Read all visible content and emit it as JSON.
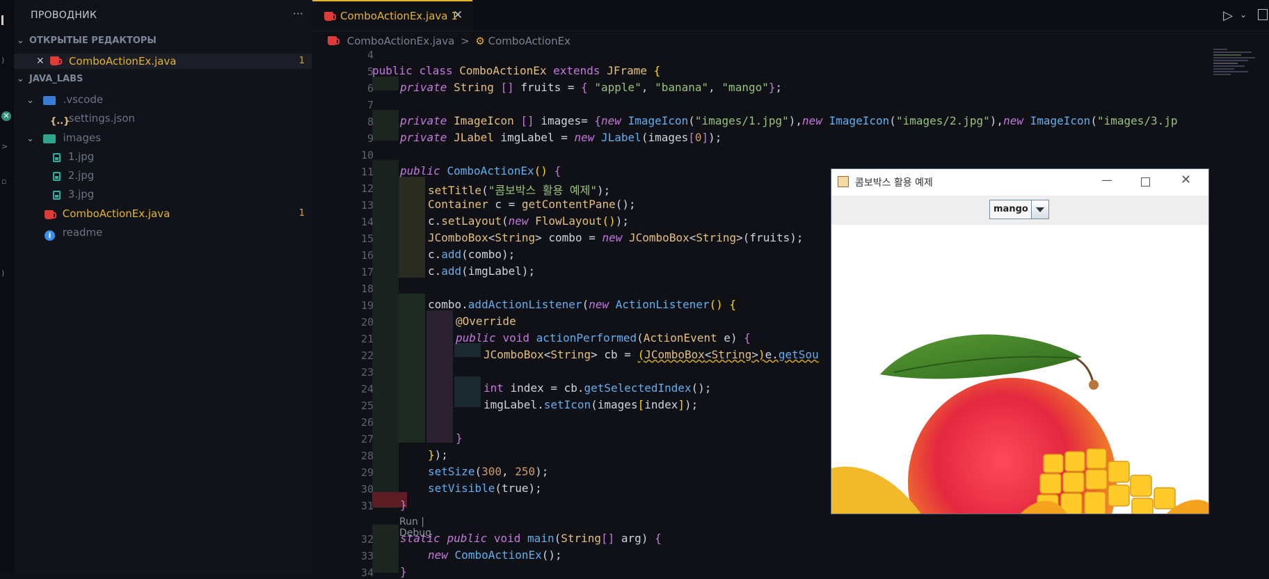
{
  "sidebar": {
    "title": "ПРОВОДНИК",
    "more": "···",
    "open_editors_label": "ОТКРЫТЫЕ РЕДАКТОРЫ",
    "open_editors": [
      {
        "name": "ComboActionEx.java",
        "badge": "1"
      }
    ],
    "project_label": "JAVA_LABS",
    "tree": [
      {
        "name": ".vscode",
        "type": "folder"
      },
      {
        "name": "settings.json",
        "type": "json"
      },
      {
        "name": "images",
        "type": "folder"
      },
      {
        "name": "1.jpg",
        "type": "image"
      },
      {
        "name": "2.jpg",
        "type": "image"
      },
      {
        "name": "3.jpg",
        "type": "image"
      },
      {
        "name": "ComboActionEx.java",
        "type": "java",
        "badge": "1"
      },
      {
        "name": "readme",
        "type": "info"
      }
    ]
  },
  "editor": {
    "tab": {
      "label": "ComboActionEx.java 1",
      "close": "✕"
    },
    "breadcrumb": {
      "file": "ComboActionEx.java",
      "sep": ">",
      "symbol": "ComboActionEx"
    },
    "codelens": "Run | Debug",
    "line_numbers": [
      "4",
      "5",
      "6",
      "7",
      "8",
      "9",
      "10",
      "11",
      "12",
      "13",
      "14",
      "15",
      "16",
      "17",
      "18",
      "19",
      "20",
      "21",
      "22",
      "23",
      "24",
      "25",
      "26",
      "27",
      "28",
      "29",
      "30",
      "31",
      "32",
      "33",
      "34"
    ]
  },
  "java_window": {
    "title": "콤보박스 활용 예제",
    "combo_value": "mango",
    "image": "mango"
  },
  "colors": {
    "accent": "#e4b52b",
    "background": "#0f1117",
    "sidebar": "#11131a"
  }
}
